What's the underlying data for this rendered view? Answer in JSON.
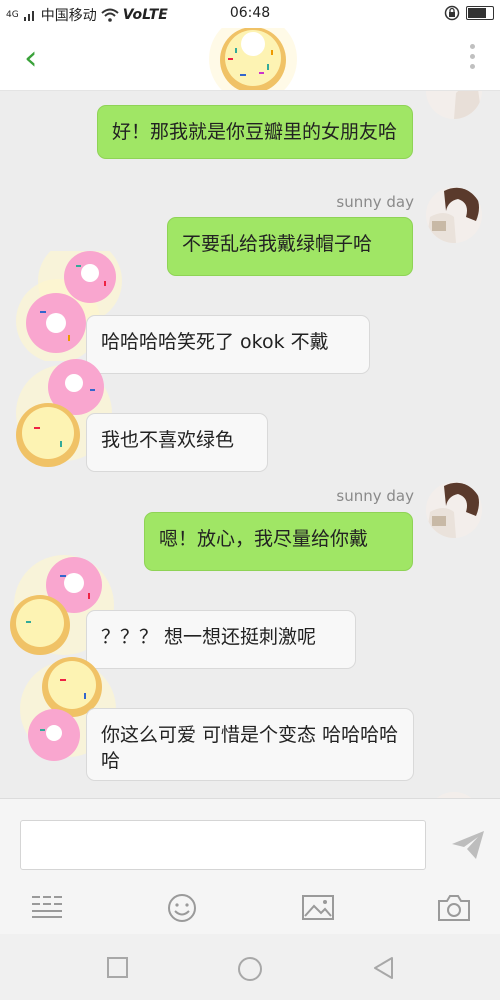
{
  "status_bar": {
    "network_type": "4G",
    "carrier": "中国移动",
    "volte": "VoLTE",
    "time": "06:48"
  },
  "header": {
    "back_icon": "chevron-left-icon",
    "avatar_icon": "donut-icon",
    "menu_icon": "more-vertical-icon",
    "accent_color": "#3aa23a"
  },
  "messages": [
    {
      "side": "out",
      "text": "好！那我就是你豆瓣里的女朋友哈"
    },
    {
      "side": "out",
      "name": "sunny day",
      "text": "不要乱给我戴绿帽子哈"
    },
    {
      "side": "in",
      "text": "哈哈哈哈笑死了 okok 不戴"
    },
    {
      "side": "in",
      "text": "我也不喜欢绿色"
    },
    {
      "side": "out",
      "name": "sunny day",
      "text": "嗯！放心，我尽量给你戴"
    },
    {
      "side": "in",
      "text": "？？？ 想一想还挺刺激呢"
    },
    {
      "side": "in",
      "text": "你这么可爱 可惜是个变态 哈哈哈哈哈"
    }
  ],
  "colors": {
    "outgoing_bubble": "#a0e665",
    "incoming_bubble": "#f8f8f8",
    "background": "#ededed"
  },
  "input": {
    "value": "",
    "placeholder": ""
  },
  "toolbar": [
    "keyboard-icon",
    "emoji-icon",
    "image-icon",
    "camera-icon",
    "send-icon"
  ],
  "nav_bar": [
    "recent-apps-icon",
    "home-icon",
    "back-icon"
  ]
}
